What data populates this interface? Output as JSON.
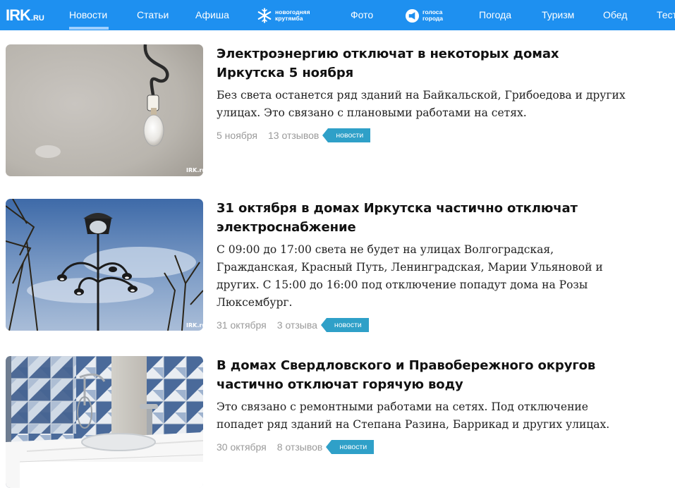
{
  "header": {
    "logo_main": "IRK",
    "logo_domain": ".RU",
    "nav": [
      "Новости",
      "Статьи",
      "Афиша",
      "Фото",
      "Погода",
      "Туризм",
      "Обед",
      "Тест"
    ],
    "active_item": "Новости",
    "promo_newyear": [
      "новогодняя",
      "крутямба"
    ],
    "promo_voice": [
      "голоса",
      "города"
    ]
  },
  "articles": [
    {
      "title": "Электроэнергию отключат в некоторых домах Иркутска 5 ноября",
      "lead": "Без света останется ряд зданий на Байкальской, Грибоедова и других улицах. Это связано с плановыми работами на сетях.",
      "date": "5 ноября",
      "comments": "13 отзывов",
      "tag": "новости",
      "image_watermark": "IRK.ru"
    },
    {
      "title": "31 октября в домах Иркутска частично отключат электроснабжение",
      "lead": "С 09:00 до 17:00 света не будет на улицах Волгоградская, Гражданская, Красный Путь, Ленинградская, Марии Ульяновой и других. С 15:00 до 16:00 под отключение попадут дома на Розы Люксембург.",
      "date": "31 октября",
      "comments": "3 отзыва",
      "tag": "новости",
      "image_watermark": "IRK.ru"
    },
    {
      "title": "В домах Свердловского и Правобережного округов частично отключат горячую воду",
      "lead": "Это связано с ремонтными работами на сетях. Под отключение попадет ряд зданий на Степана Разина, Баррикад и других улицах.",
      "date": "30 октября",
      "comments": "8 отзывов",
      "tag": "новости"
    }
  ]
}
